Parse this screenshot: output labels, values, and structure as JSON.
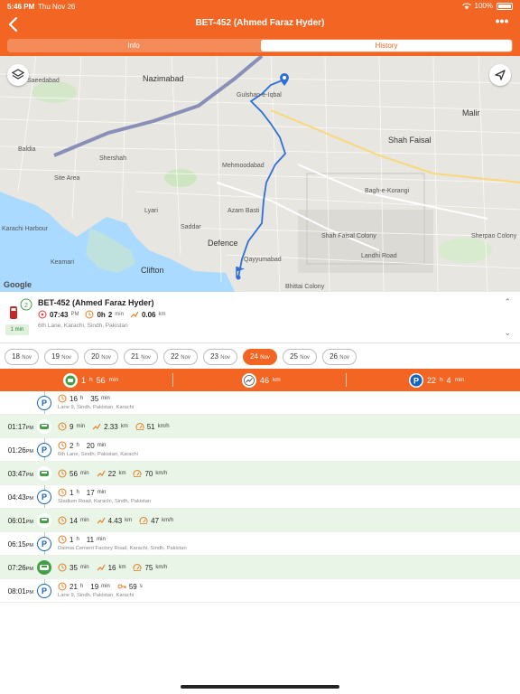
{
  "status_bar": {
    "time": "5:46 PM",
    "date": "Thu Nov 26",
    "battery": "100%"
  },
  "nav": {
    "title": "BET-452 (Ahmed Faraz Hyder)",
    "more": "•••"
  },
  "tabs": [
    {
      "label": "Info"
    },
    {
      "label": "History",
      "selected": true
    }
  ],
  "map": {
    "labels": [
      "Nazimabad",
      "Saeedabad",
      "Gulshan-e-Iqbal",
      "Malir",
      "Shah Faisal",
      "Site Area",
      "Lyari",
      "Defence",
      "Clifton",
      "Keamari",
      "Karachi Harbour",
      "Bagh-e-Korangi",
      "Shah Faisal Colony",
      "Landhi Road",
      "Qayyumabad",
      "Bhittai Colony",
      "Saddar",
      "Mehmoodabad",
      "Azam Basti",
      "Shershah",
      "Baldia",
      "Sherpao Colony"
    ],
    "attribution": "Google"
  },
  "vehicle": {
    "title": "BET-452 (Ahmed Faraz Hyder)",
    "badge": "1 min",
    "time": "07:43",
    "time_suffix": "PM",
    "duration_h": "0h",
    "duration_m": "2",
    "duration_unit": "min",
    "distance": "0.06",
    "distance_unit": "km",
    "address": "6th Lane, Karachi, Sindh, Pakistan"
  },
  "dates": [
    {
      "day": "18",
      "mon": "Nov"
    },
    {
      "day": "19",
      "mon": "Nov"
    },
    {
      "day": "20",
      "mon": "Nov"
    },
    {
      "day": "21",
      "mon": "Nov"
    },
    {
      "day": "22",
      "mon": "Nov"
    },
    {
      "day": "23",
      "mon": "Nov"
    },
    {
      "day": "24",
      "mon": "Nov",
      "active": true
    },
    {
      "day": "25",
      "mon": "Nov"
    },
    {
      "day": "26",
      "mon": "Nov"
    }
  ],
  "summary": {
    "drive_h": "1",
    "drive_h_unit": "h",
    "drive_m": "56",
    "drive_m_unit": "min",
    "distance": "46",
    "distance_unit": "km",
    "park_h": "22",
    "park_h_unit": "h",
    "park_m": "4",
    "park_m_unit": "min"
  },
  "colors": {
    "brand": "#F26522",
    "drive_bg": "#e9f5e6",
    "park_blue": "#1565c0",
    "drive_green": "#43a047"
  },
  "timeline": [
    {
      "type": "park",
      "time": "",
      "ap": "",
      "a": "16",
      "au": "h",
      "b": "35",
      "bu": "min",
      "address": "Lane 9, Sindh, Pakistan, Karachi"
    },
    {
      "type": "drive",
      "time": "01:17",
      "ap": "PM",
      "dur": "9",
      "duru": "min",
      "dist": "2.33",
      "distu": "km",
      "speed": "51",
      "speedu": "km/h"
    },
    {
      "type": "park",
      "time": "01:26",
      "ap": "PM",
      "a": "2",
      "au": "h",
      "b": "20",
      "bu": "min",
      "address": "6th Lane, Sindh, Pakistan, Karachi"
    },
    {
      "type": "drive",
      "time": "03:47",
      "ap": "PM",
      "dur": "56",
      "duru": "min",
      "dist": "22",
      "distu": "km",
      "speed": "70",
      "speedu": "km/h"
    },
    {
      "type": "park",
      "time": "04:43",
      "ap": "PM",
      "a": "1",
      "au": "h",
      "b": "17",
      "bu": "min",
      "address": "Stadium Road, Karachi, Sindh, Pakistan"
    },
    {
      "type": "drive",
      "time": "06:01",
      "ap": "PM",
      "dur": "14",
      "duru": "min",
      "dist": "4.43",
      "distu": "km",
      "speed": "47",
      "speedu": "km/h"
    },
    {
      "type": "park",
      "time": "06:15",
      "ap": "PM",
      "a": "1",
      "au": "h",
      "b": "11",
      "bu": "min",
      "address": "Dalmia Cement Factory Road, Karachi, Sindh, Pakistan"
    },
    {
      "type": "drive",
      "time": "07:26",
      "ap": "PM",
      "dur": "35",
      "duru": "min",
      "dist": "16",
      "distu": "km",
      "speed": "75",
      "speedu": "km/h",
      "solid": true
    },
    {
      "type": "park",
      "time": "08:01",
      "ap": "PM",
      "a": "21",
      "au": "h",
      "b": "19",
      "bu": "min",
      "extra": "59",
      "extrau": "s",
      "address": "Lane 9, Sindh, Pakistan, Karachi"
    }
  ]
}
